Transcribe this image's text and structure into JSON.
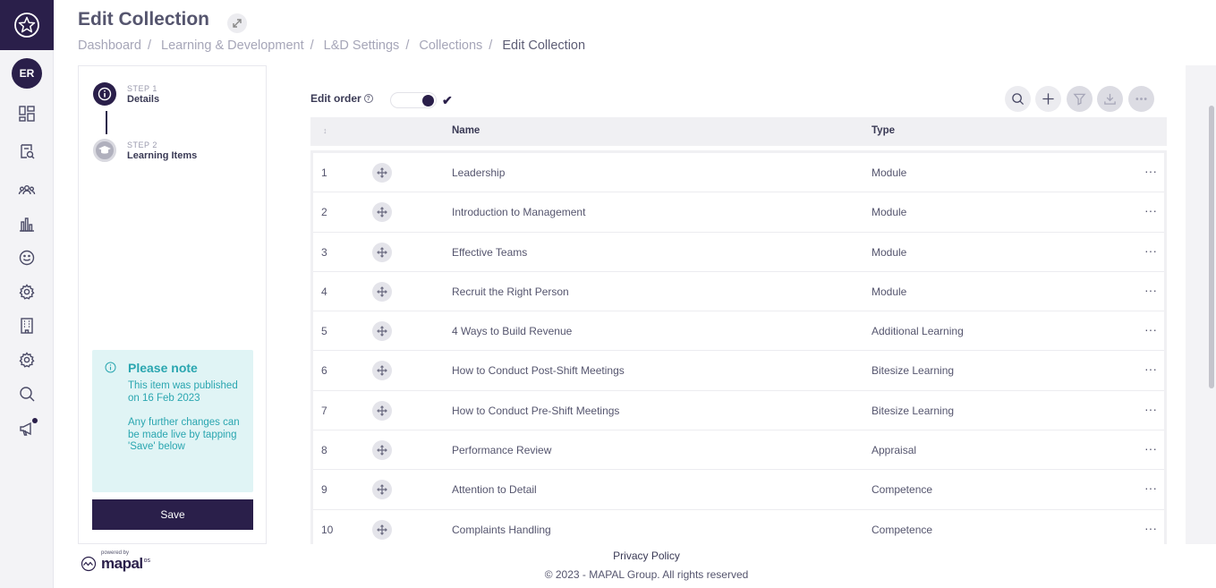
{
  "header": {
    "title": "Edit Collection",
    "breadcrumb": [
      "Dashboard",
      "Learning & Development",
      "L&D Settings",
      "Collections",
      "Edit Collection"
    ]
  },
  "user": {
    "initials": "ER"
  },
  "sidebar": {
    "icons": [
      "dashboard-icon",
      "search-document-icon",
      "people-icon",
      "chart-icon",
      "smile-icon",
      "settings-icon",
      "building-icon",
      "settings-icon",
      "search-icon",
      "megaphone-icon"
    ]
  },
  "steps": [
    {
      "number": "STEP 1",
      "label": "Details"
    },
    {
      "number": "STEP 2",
      "label": "Learning Items"
    }
  ],
  "note": {
    "title": "Please note",
    "line1": "This item was published on 16 Feb 2023",
    "line2": "Any further changes can be made live by tapping 'Save' below"
  },
  "save_label": "Save",
  "toolbar": {
    "edit_order_label": "Edit order",
    "edit_order_enabled": true
  },
  "table": {
    "columns": {
      "name": "Name",
      "type": "Type"
    },
    "rows": [
      {
        "num": "1",
        "name": "Leadership",
        "type": "Module"
      },
      {
        "num": "2",
        "name": "Introduction to Management",
        "type": "Module"
      },
      {
        "num": "3",
        "name": "Effective Teams",
        "type": "Module"
      },
      {
        "num": "4",
        "name": "Recruit the Right Person",
        "type": "Module"
      },
      {
        "num": "5",
        "name": "4 Ways to Build Revenue",
        "type": "Additional Learning"
      },
      {
        "num": "6",
        "name": "How to Conduct Post-Shift Meetings",
        "type": "Bitesize Learning"
      },
      {
        "num": "7",
        "name": "How to Conduct Pre-Shift Meetings",
        "type": "Bitesize Learning"
      },
      {
        "num": "8",
        "name": "Performance Review",
        "type": "Appraisal"
      },
      {
        "num": "9",
        "name": "Attention to Detail",
        "type": "Competence"
      },
      {
        "num": "10",
        "name": "Complaints Handling",
        "type": "Competence"
      }
    ]
  },
  "footer": {
    "powered_by": "powered by",
    "brand": "mapal",
    "brand_suffix": "os",
    "privacy": "Privacy Policy",
    "copyright": "© 2023 - MAPAL Group. All rights reserved"
  }
}
